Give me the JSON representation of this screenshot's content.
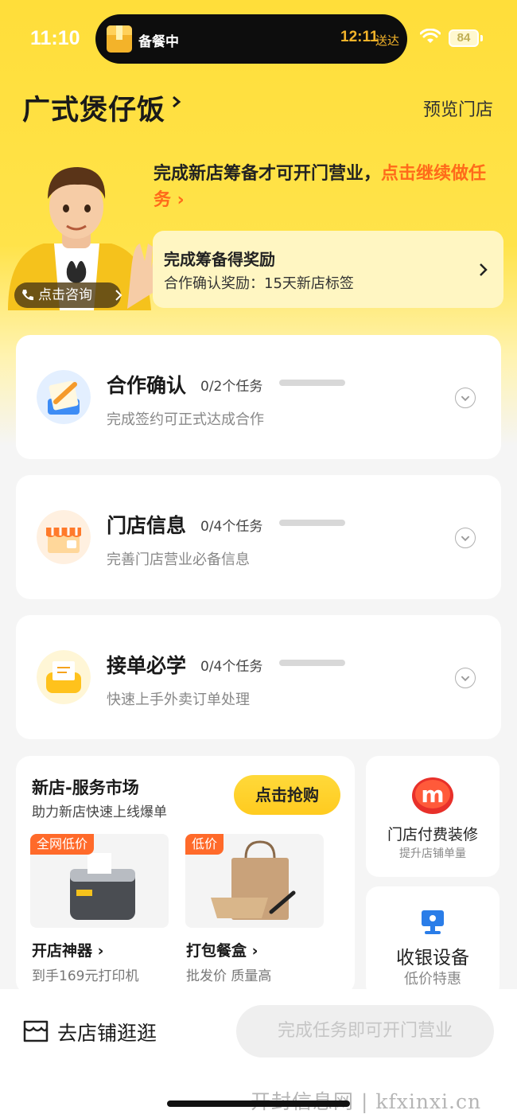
{
  "status_bar": {
    "time": "11:10",
    "island_label": "备餐中",
    "island_time": "12:11",
    "island_suffix": "送达",
    "battery": "84"
  },
  "header": {
    "store_name": "广式煲仔饭",
    "preview_label": "预览门店"
  },
  "banner": {
    "consult_label": "点击咨询",
    "notice_text": "完成新店筹备才可开门营业，",
    "notice_link": "点击继续做任务",
    "reward_title": "完成筹备得奖励",
    "reward_sub": "合作确认奖励：15天新店标签"
  },
  "tasks": [
    {
      "title": "合作确认",
      "count": "0/2个任务",
      "sub": "完成签约可正式达成合作",
      "icon": "contract-icon"
    },
    {
      "title": "门店信息",
      "count": "0/4个任务",
      "sub": "完善门店营业必备信息",
      "icon": "storefront-icon"
    },
    {
      "title": "接单必学",
      "count": "0/4个任务",
      "sub": "快速上手外卖订单处理",
      "icon": "order-printer-icon"
    }
  ],
  "market": {
    "title": "新店-服务市场",
    "sub": "助力新店快速上线爆单",
    "button": "点击抢购",
    "products": [
      {
        "tag": "全网低价",
        "name": "开店神器",
        "desc": "到手169元打印机",
        "icon": "receipt-printer-icon"
      },
      {
        "tag": "低价",
        "name": "打包餐盒",
        "desc": "批发价 质量高",
        "icon": "takeout-bag-icon"
      }
    ]
  },
  "side_cards": [
    {
      "label": "门店付费装修",
      "sub": "提升店铺单量",
      "icon": "m-logo-icon"
    },
    {
      "label": "收银设备",
      "sub": "低价特惠",
      "icon": "cash-register-icon"
    }
  ],
  "bottom_bar": {
    "shop_label": "去店铺逛逛",
    "open_button": "完成任务即可开门营业"
  },
  "watermark": "开封信息网 | kfxinxi.cn",
  "colors": {
    "accent": "#ffd93a",
    "highlight": "#ff6a1a",
    "tag": "#ff6a2a"
  }
}
